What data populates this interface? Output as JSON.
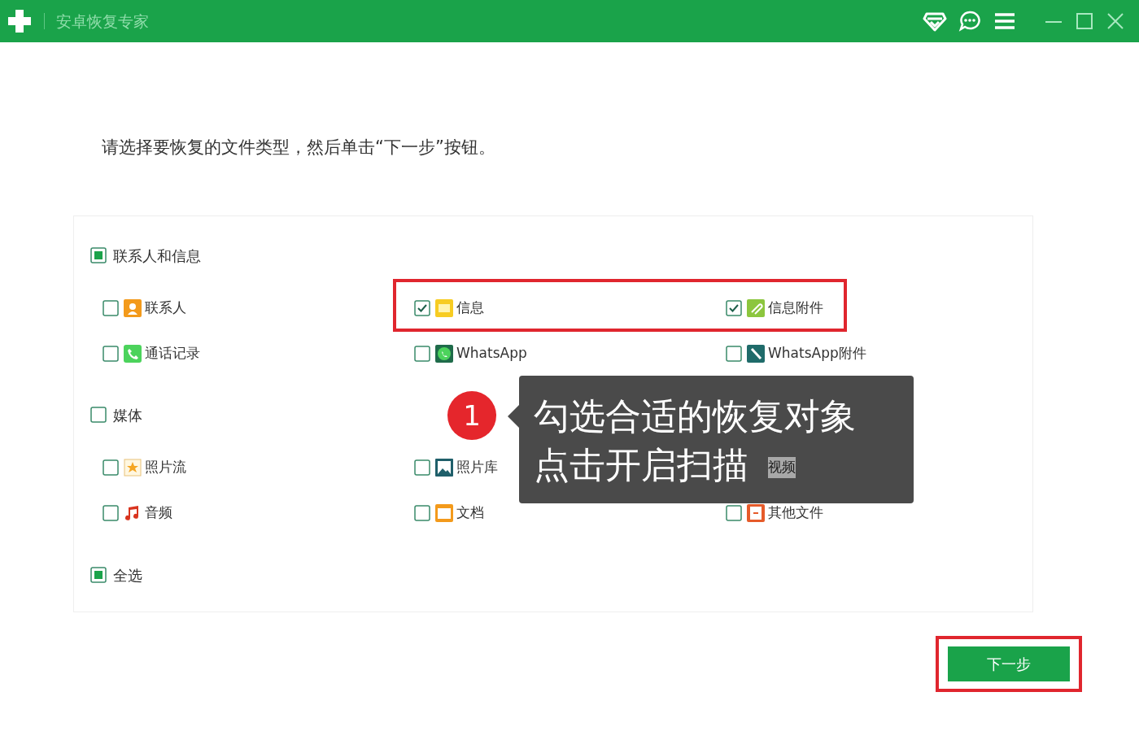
{
  "window": {
    "title": "安卓恢复专家"
  },
  "instruction": "请选择要恢复的文件类型，然后单击“下一步”按钮。",
  "groups": [
    {
      "label": "联系人和信息",
      "checked": true,
      "items": [
        {
          "label": "联系人",
          "checked": false
        },
        {
          "label": "信息",
          "checked": true,
          "highlighted": true
        },
        {
          "label": "信息附件",
          "checked": true,
          "highlighted": true
        },
        {
          "label": "通话记录",
          "checked": false
        },
        {
          "label": "WhatsApp",
          "checked": false
        },
        {
          "label": "WhatsApp附件",
          "checked": false
        }
      ]
    },
    {
      "label": "媒体",
      "checked": false,
      "items": [
        {
          "label": "照片流",
          "checked": false
        },
        {
          "label": "照片库",
          "checked": false
        },
        {
          "label": "视频"
        },
        {
          "label": "音频",
          "checked": false
        },
        {
          "label": "文档",
          "checked": false
        },
        {
          "label": "其他文件",
          "checked": false
        }
      ]
    }
  ],
  "select_all": {
    "label": "全选",
    "checked": true
  },
  "next_button": {
    "label": "下一步",
    "highlighted": true
  },
  "callout": {
    "number": "1",
    "lines": [
      "勾选合适的恢复对象",
      "点击开启扫描"
    ]
  }
}
